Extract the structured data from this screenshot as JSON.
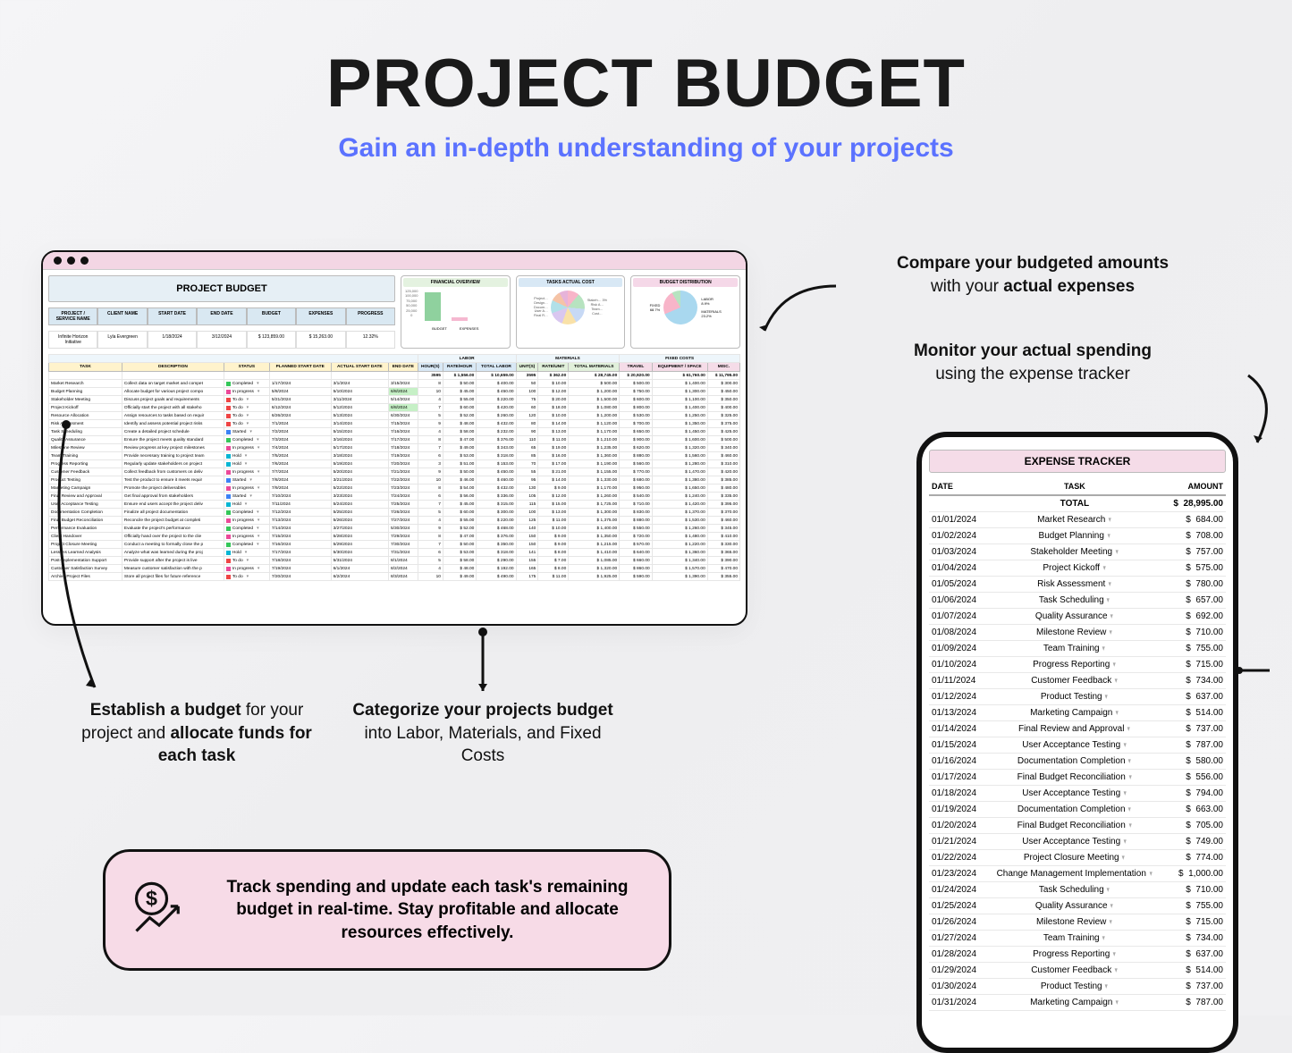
{
  "header": {
    "title": "PROJECT BUDGET",
    "subtitle": "Gain an in-depth understanding of your projects"
  },
  "callouts": {
    "compare": {
      "bold1": "Compare your budgeted amounts",
      "rest": " with your ",
      "bold2": "actual expenses"
    },
    "monitor": {
      "bold1": "Monitor your actual spending",
      "rest": " using the expense tracker"
    },
    "establish": {
      "bold1": "Establish a budget",
      "mid": " for your project and ",
      "bold2": "allocate funds for each task"
    },
    "categorize": {
      "bold1": "Categorize your projects budget",
      "rest": " into Labor, Materials, and Fixed Costs"
    },
    "pill": "Track spending and update each task's remaining budget in real-time. Stay profitable and allocate resources effectively."
  },
  "sheet": {
    "title": "PROJECT BUDGET",
    "info_headers": [
      "PROJECT / SERVICE NAME",
      "CLIENT NAME",
      "START DATE",
      "END DATE",
      "BUDGET",
      "EXPENSES",
      "PROGRESS"
    ],
    "info_values": [
      "Infinite Horizon Initiative",
      "Lyla Evergreen",
      "1/18/2024",
      "3/12/2024",
      "$ 123,859.00",
      "$ 15,263.00",
      "12.32%"
    ],
    "panels": {
      "overview": {
        "title": "FINANCIAL OVERVIEW",
        "labels": [
          "BUDGET",
          "EXPENSES"
        ],
        "ticks": [
          "125,000",
          "100,000",
          "75,000",
          "50,000",
          "25,000",
          "0"
        ],
        "bars": [
          100,
          12
        ]
      },
      "actual": {
        "title": "TASKS ACTUAL COST",
        "legend": [
          "Project…",
          "Design…",
          "Docum…",
          "User A…",
          "Final R…",
          "Stakeh… 3%",
          "Risk A…",
          "Team…",
          "Cust…"
        ]
      },
      "dist": {
        "title": "BUDGET DISTRIBUTION",
        "legend": [
          "LABOR 8.9%",
          "MATERIALS 23.2%",
          "FIXED 68.7%"
        ]
      }
    },
    "group_headers": [
      "LABOR",
      "MATERIALS",
      "FIXED COSTS"
    ],
    "col_headers": [
      "TASK",
      "DESCRIPTION",
      "STATUS",
      "PLANNED START DATE",
      "ACTUAL START DATE",
      "END DATE",
      "HOUR(S)",
      "RATE/HOUR",
      "TOTAL LABOR",
      "UNIT(S)",
      "RATE/UNIT",
      "TOTAL MATERIALS",
      "TRAVEL",
      "EQUIPMENT / SPACE",
      "MISC."
    ],
    "tot_row": [
      "",
      "",
      "",
      "",
      "",
      "",
      "3595",
      "$ 1,556.00",
      "$ 10,659.00",
      "3595",
      "$ 362.00",
      "$ 28,745.00",
      "$ 20,920.00",
      "$ 61,760.00",
      "$ 11,795.00"
    ],
    "tasks": [
      {
        "t": "Market Research",
        "d": "Collect data on target market and compet",
        "s": "Completed",
        "sc": "g",
        "p": "1/17/2024",
        "a": "3/1/2024",
        "e": "3/15/2024",
        "h": 8,
        "rh": "50.00",
        "tl": "400.00",
        "u": 50,
        "ru": "10.00",
        "tm": "500.00",
        "tr": "500.00",
        "eq": "1,400.00",
        "mi": "300.00"
      },
      {
        "t": "Budget Planning",
        "d": "Allocate budget for various project compo",
        "s": "In progress",
        "sc": "p",
        "p": "5/8/2024",
        "a": "5/10/2024",
        "e": "6/8/2024",
        "hl": 1,
        "h": 10,
        "rh": "45.00",
        "tl": "450.00",
        "u": 100,
        "ru": "12.00",
        "tm": "1,200.00",
        "tr": "750.00",
        "eq": "1,300.00",
        "mi": "450.00"
      },
      {
        "t": "Stakeholder Meeting",
        "d": "Discuss project goals and requirements",
        "s": "To do",
        "sc": "r",
        "p": "5/21/2024",
        "a": "3/11/2024",
        "e": "5/14/2024",
        "h": 4,
        "rh": "55.00",
        "tl": "220.00",
        "u": 75,
        "ru": "20.00",
        "tm": "1,500.00",
        "tr": "600.00",
        "eq": "1,100.00",
        "mi": "350.00"
      },
      {
        "t": "Project Kickoff",
        "d": "Officially start the project with all stakeho",
        "s": "To do",
        "sc": "r",
        "p": "6/12/2024",
        "a": "5/12/2024",
        "e": "6/8/2024",
        "hl": 1,
        "h": 7,
        "rh": "60.00",
        "tl": "420.00",
        "u": 60,
        "ru": "18.00",
        "tm": "1,080.00",
        "tr": "800.00",
        "eq": "1,400.00",
        "mi": "400.00"
      },
      {
        "t": "Resource Allocation",
        "d": "Assign resources to tasks based on requir",
        "s": "To do",
        "sc": "r",
        "p": "6/26/2024",
        "a": "5/13/2024",
        "e": "6/30/2024",
        "h": 5,
        "rh": "52.00",
        "tl": "260.00",
        "u": 120,
        "ru": "10.00",
        "tm": "1,200.00",
        "tr": "530.00",
        "eq": "1,250.00",
        "mi": "325.00"
      },
      {
        "t": "Risk Assessment",
        "d": "Identify and assess potential project risks",
        "s": "To do",
        "sc": "r",
        "p": "7/1/2024",
        "a": "3/14/2024",
        "e": "7/15/2024",
        "h": 9,
        "rh": "48.00",
        "tl": "432.00",
        "u": 80,
        "ru": "14.00",
        "tm": "1,120.00",
        "tr": "700.00",
        "eq": "1,350.00",
        "mi": "375.00"
      },
      {
        "t": "Task Scheduling",
        "d": "Create a detailed project schedule",
        "s": "Started",
        "sc": "b",
        "p": "7/2/2024",
        "a": "5/15/2024",
        "e": "7/16/2024",
        "h": 4,
        "rh": "58.00",
        "tl": "232.00",
        "u": 90,
        "ru": "13.00",
        "tm": "1,170.00",
        "tr": "650.00",
        "eq": "1,450.00",
        "mi": "425.00"
      },
      {
        "t": "Quality Assurance",
        "d": "Ensure the project meets quality standard",
        "s": "Completed",
        "sc": "g",
        "p": "7/3/2024",
        "a": "3/16/2024",
        "e": "7/17/2024",
        "h": 8,
        "rh": "47.00",
        "tl": "376.00",
        "u": 110,
        "ru": "11.00",
        "tm": "1,210.00",
        "tr": "900.00",
        "eq": "1,600.00",
        "mi": "500.00"
      },
      {
        "t": "Milestone Review",
        "d": "Review progress at key project milestones",
        "s": "In progress",
        "sc": "p",
        "p": "7/4/2024",
        "a": "5/17/2024",
        "e": "7/18/2024",
        "h": 7,
        "rh": "49.00",
        "tl": "343.00",
        "u": 65,
        "ru": "19.00",
        "tm": "1,235.00",
        "tr": "620.00",
        "eq": "1,320.00",
        "mi": "340.00"
      },
      {
        "t": "Team Training",
        "d": "Provide necessary training to project team",
        "s": "Hold",
        "sc": "c",
        "p": "7/5/2024",
        "a": "3/18/2024",
        "e": "7/19/2024",
        "h": 6,
        "rh": "53.00",
        "tl": "318.00",
        "u": 85,
        "ru": "16.00",
        "tm": "1,360.00",
        "tr": "880.00",
        "eq": "1,560.00",
        "mi": "460.00"
      },
      {
        "t": "Progress Reporting",
        "d": "Regularly update stakeholders on project",
        "s": "Hold",
        "sc": "c",
        "p": "7/6/2024",
        "a": "5/19/2024",
        "e": "7/20/2024",
        "h": 3,
        "rh": "51.00",
        "tl": "153.00",
        "u": 70,
        "ru": "17.00",
        "tm": "1,190.00",
        "tr": "560.00",
        "eq": "1,280.00",
        "mi": "310.00"
      },
      {
        "t": "Customer Feedback",
        "d": "Collect feedback from customers on deliv",
        "s": "In progress",
        "sc": "p",
        "p": "7/7/2024",
        "a": "5/20/2024",
        "e": "7/21/2024",
        "h": 9,
        "rh": "50.00",
        "tl": "450.00",
        "u": 55,
        "ru": "21.00",
        "tm": "1,155.00",
        "tr": "770.00",
        "eq": "1,470.00",
        "mi": "420.00"
      },
      {
        "t": "Product Testing",
        "d": "Test the product to ensure it meets requir",
        "s": "Started",
        "sc": "b",
        "p": "7/8/2024",
        "a": "3/21/2024",
        "e": "7/22/2024",
        "h": 10,
        "rh": "46.00",
        "tl": "460.00",
        "u": 95,
        "ru": "14.00",
        "tm": "1,330.00",
        "tr": "680.00",
        "eq": "1,380.00",
        "mi": "385.00"
      },
      {
        "t": "Marketing Campaign",
        "d": "Promote the project deliverables",
        "s": "In progress",
        "sc": "p",
        "p": "7/9/2024",
        "a": "5/22/2024",
        "e": "7/23/2024",
        "h": 8,
        "rh": "54.00",
        "tl": "432.00",
        "u": 130,
        "ru": "9.00",
        "tm": "1,170.00",
        "tr": "950.00",
        "eq": "1,650.00",
        "mi": "480.00"
      },
      {
        "t": "Final Review and Approval",
        "d": "Get final approval from stakeholders",
        "s": "Started",
        "sc": "b",
        "p": "7/10/2024",
        "a": "3/23/2024",
        "e": "7/24/2024",
        "h": 6,
        "rh": "56.00",
        "tl": "336.00",
        "u": 105,
        "ru": "12.00",
        "tm": "1,260.00",
        "tr": "540.00",
        "eq": "1,240.00",
        "mi": "335.00"
      },
      {
        "t": "User Acceptance Testing",
        "d": "Ensure end users accept the project deliv",
        "s": "Hold",
        "sc": "c",
        "p": "7/11/2024",
        "a": "5/24/2024",
        "e": "7/25/2024",
        "h": 7,
        "rh": "45.00",
        "tl": "315.00",
        "u": 115,
        "ru": "15.00",
        "tm": "1,725.00",
        "tr": "710.00",
        "eq": "1,420.00",
        "mi": "395.00"
      },
      {
        "t": "Documentation Completion",
        "d": "Finalize all project documentation",
        "s": "Completed",
        "sc": "g",
        "p": "7/12/2024",
        "a": "5/25/2024",
        "e": "7/26/2024",
        "h": 5,
        "rh": "60.00",
        "tl": "300.00",
        "u": 100,
        "ru": "13.00",
        "tm": "1,300.00",
        "tr": "830.00",
        "eq": "1,370.00",
        "mi": "370.00"
      },
      {
        "t": "Final Budget Reconciliation",
        "d": "Reconcile the project budget at completi",
        "s": "In progress",
        "sc": "p",
        "p": "7/13/2024",
        "a": "5/26/2024",
        "e": "7/27/2024",
        "h": 4,
        "rh": "55.00",
        "tl": "220.00",
        "u": 125,
        "ru": "11.00",
        "tm": "1,375.00",
        "tr": "880.00",
        "eq": "1,530.00",
        "mi": "460.00"
      },
      {
        "t": "Performance Evaluation",
        "d": "Evaluate the project's performance",
        "s": "Completed",
        "sc": "g",
        "p": "7/14/2024",
        "a": "3/27/2024",
        "e": "5/30/2024",
        "h": 9,
        "rh": "52.00",
        "tl": "468.00",
        "u": 140,
        "ru": "10.00",
        "tm": "1,400.00",
        "tr": "550.00",
        "eq": "1,260.00",
        "mi": "345.00"
      },
      {
        "t": "Client Handover",
        "d": "Officially hand over the project to the clie",
        "s": "In progress",
        "sc": "p",
        "p": "7/15/2024",
        "a": "5/28/2024",
        "e": "7/29/2024",
        "h": 8,
        "rh": "47.00",
        "tl": "376.00",
        "u": 150,
        "ru": "9.00",
        "tm": "1,350.00",
        "tr": "720.00",
        "eq": "1,480.00",
        "mi": "410.00"
      },
      {
        "t": "Project Closure Meeting",
        "d": "Conduct a meeting to formally close the p",
        "s": "Completed",
        "sc": "g",
        "p": "7/16/2024",
        "a": "5/29/2024",
        "e": "7/30/2024",
        "h": 7,
        "rh": "50.00",
        "tl": "350.00",
        "u": 150,
        "ru": "9.00",
        "tm": "1,215.00",
        "tr": "570.00",
        "eq": "1,220.00",
        "mi": "330.00"
      },
      {
        "t": "Lessons Learned Analysis",
        "d": "Analyze what was learned during the proj",
        "s": "Hold",
        "sc": "c",
        "p": "7/17/2024",
        "a": "5/30/2024",
        "e": "7/31/2024",
        "h": 6,
        "rh": "53.00",
        "tl": "318.00",
        "u": 141,
        "ru": "8.00",
        "tm": "1,410.00",
        "tr": "640.00",
        "eq": "1,360.00",
        "mi": "365.00"
      },
      {
        "t": "Post-Implementation Support",
        "d": "Provide support after the project is live",
        "s": "To do",
        "sc": "r",
        "p": "7/18/2024",
        "a": "5/31/2024",
        "e": "8/1/2024",
        "h": 5,
        "rh": "58.00",
        "tl": "290.00",
        "u": 155,
        "ru": "7.00",
        "tm": "1,085.00",
        "tr": "660.00",
        "eq": "1,340.00",
        "mi": "390.00"
      },
      {
        "t": "Customer Satisfaction Survey",
        "d": "Measure customer satisfaction with the p",
        "s": "In progress",
        "sc": "p",
        "p": "7/19/2024",
        "a": "6/1/2024",
        "e": "8/2/2024",
        "h": 4,
        "rh": "48.00",
        "tl": "192.00",
        "u": 165,
        "ru": "8.00",
        "tm": "1,320.00",
        "tr": "860.00",
        "eq": "1,570.00",
        "mi": "470.00"
      },
      {
        "t": "Archive Project Files",
        "d": "Store all project files for future reference",
        "s": "To do",
        "sc": "r",
        "p": "7/20/2024",
        "a": "6/2/2024",
        "e": "8/3/2024",
        "h": 10,
        "rh": "49.00",
        "tl": "490.00",
        "u": 175,
        "ru": "11.00",
        "tm": "1,925.00",
        "tr": "590.00",
        "eq": "1,390.00",
        "mi": "355.00"
      }
    ]
  },
  "tracker": {
    "title": "EXPENSE TRACKER",
    "headers": [
      "DATE",
      "TASK",
      "AMOUNT"
    ],
    "total_label": "TOTAL",
    "total_amount": "28,995.00",
    "rows": [
      [
        "01/01/2024",
        "Market Research",
        "684.00"
      ],
      [
        "01/02/2024",
        "Budget Planning",
        "708.00"
      ],
      [
        "01/03/2024",
        "Stakeholder Meeting",
        "757.00"
      ],
      [
        "01/04/2024",
        "Project Kickoff",
        "575.00"
      ],
      [
        "01/05/2024",
        "Risk Assessment",
        "780.00"
      ],
      [
        "01/06/2024",
        "Task Scheduling",
        "657.00"
      ],
      [
        "01/07/2024",
        "Quality Assurance",
        "692.00"
      ],
      [
        "01/08/2024",
        "Milestone Review",
        "710.00"
      ],
      [
        "01/09/2024",
        "Team Training",
        "755.00"
      ],
      [
        "01/10/2024",
        "Progress Reporting",
        "715.00"
      ],
      [
        "01/11/2024",
        "Customer Feedback",
        "734.00"
      ],
      [
        "01/12/2024",
        "Product Testing",
        "637.00"
      ],
      [
        "01/13/2024",
        "Marketing Campaign",
        "514.00"
      ],
      [
        "01/14/2024",
        "Final Review and Approval",
        "737.00"
      ],
      [
        "01/15/2024",
        "User Acceptance Testing",
        "787.00"
      ],
      [
        "01/16/2024",
        "Documentation Completion",
        "580.00"
      ],
      [
        "01/17/2024",
        "Final Budget Reconciliation",
        "556.00"
      ],
      [
        "01/18/2024",
        "User Acceptance Testing",
        "794.00"
      ],
      [
        "01/19/2024",
        "Documentation Completion",
        "663.00"
      ],
      [
        "01/20/2024",
        "Final Budget Reconciliation",
        "705.00"
      ],
      [
        "01/21/2024",
        "User Acceptance Testing",
        "749.00"
      ],
      [
        "01/22/2024",
        "Project Closure Meeting",
        "774.00"
      ],
      [
        "01/23/2024",
        "Change Management Implementation",
        "1,000.00"
      ],
      [
        "01/24/2024",
        "Task Scheduling",
        "710.00"
      ],
      [
        "01/25/2024",
        "Quality Assurance",
        "755.00"
      ],
      [
        "01/26/2024",
        "Milestone Review",
        "715.00"
      ],
      [
        "01/27/2024",
        "Team Training",
        "734.00"
      ],
      [
        "01/28/2024",
        "Progress Reporting",
        "637.00"
      ],
      [
        "01/29/2024",
        "Customer Feedback",
        "514.00"
      ],
      [
        "01/30/2024",
        "Product Testing",
        "737.00"
      ],
      [
        "01/31/2024",
        "Marketing Campaign",
        "787.00"
      ]
    ]
  }
}
